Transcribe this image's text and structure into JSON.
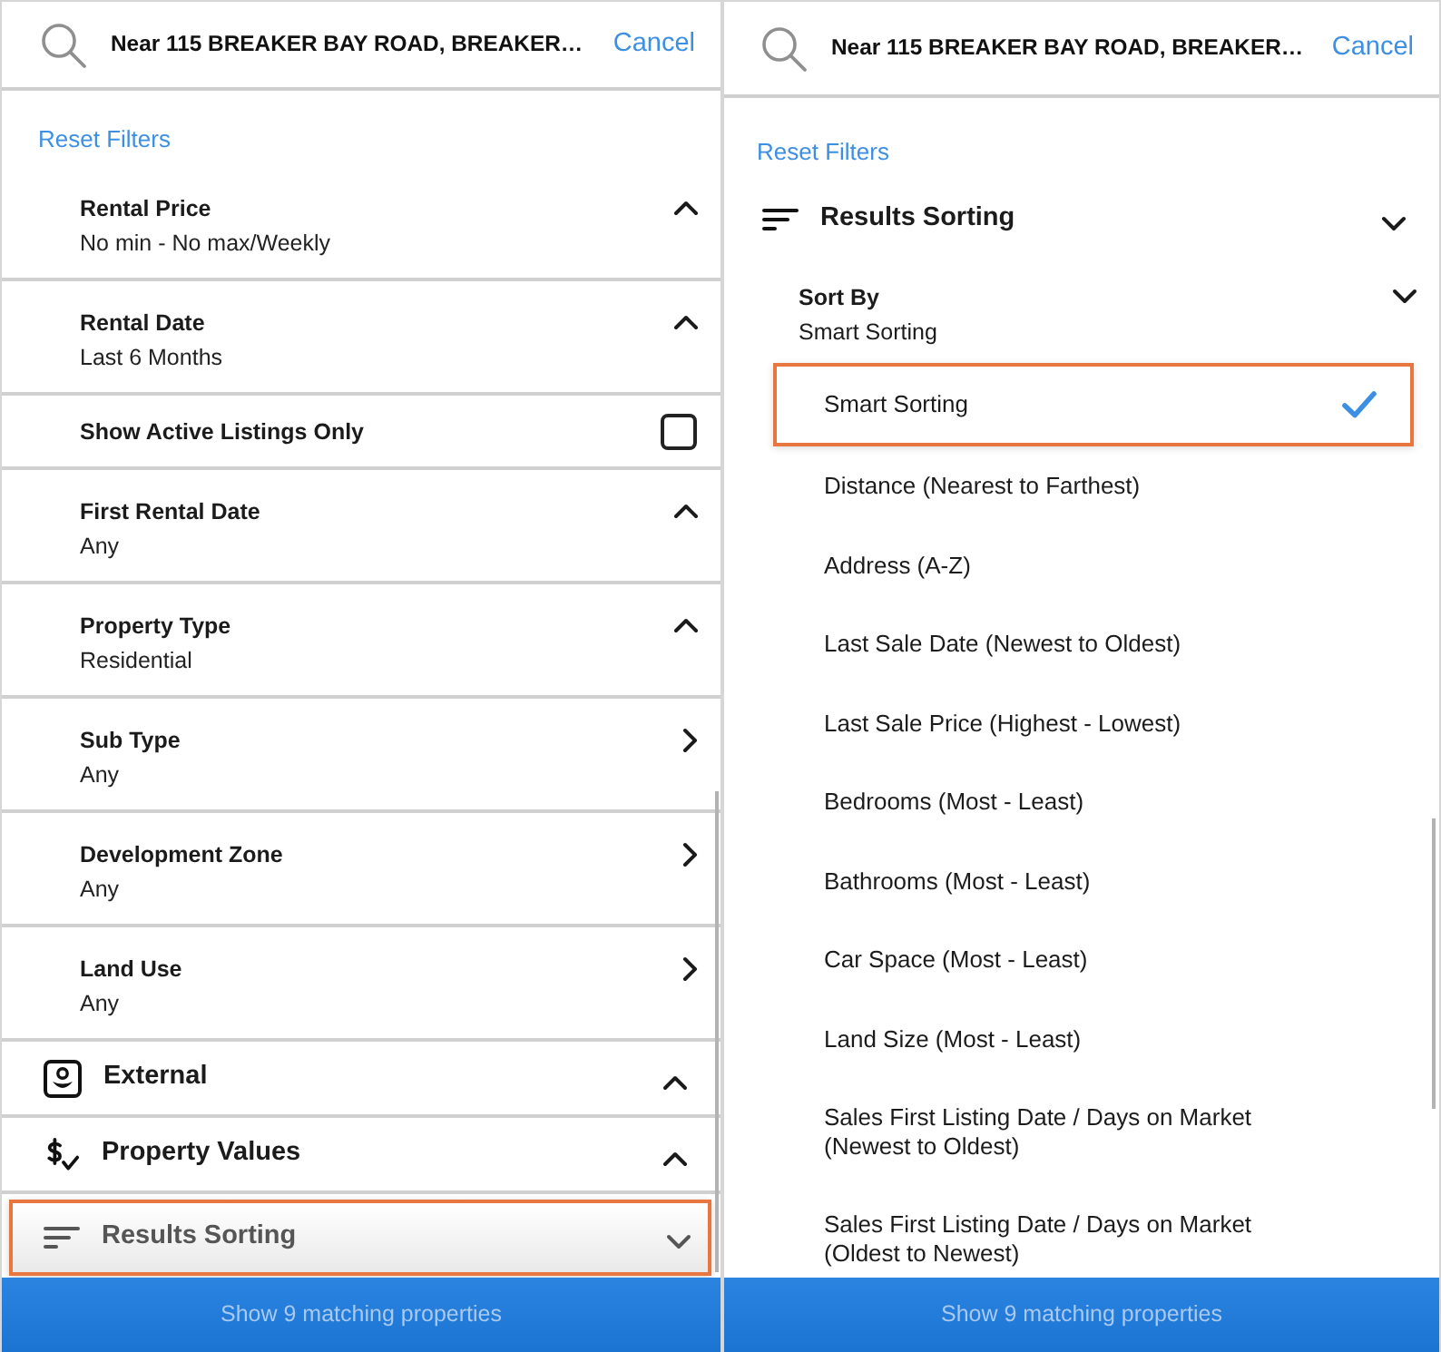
{
  "left_panel": {
    "search_text": "Near 115 BREAKER BAY ROAD, BREAKER…",
    "cancel": "Cancel",
    "reset": "Reset Filters",
    "sections": [
      {
        "kind": "filter",
        "title": "Rental Price",
        "value": "No min - No max/Weekly",
        "expanded": true,
        "highlighted": false
      },
      {
        "kind": "filter",
        "title": "Rental Date",
        "value": "Last 6 Months",
        "expanded": true,
        "highlighted": false
      },
      {
        "kind": "checkbox",
        "title": "Show Active Listings Only",
        "checked": false,
        "highlighted": false
      },
      {
        "kind": "filter",
        "title": "First Rental Date",
        "value": "Any",
        "expanded": true,
        "highlighted": false
      },
      {
        "kind": "filter",
        "title": "Property Type",
        "value": "Residential",
        "expanded": true,
        "highlighted": false
      },
      {
        "kind": "nav",
        "title": "Sub Type",
        "value": "Any",
        "highlighted": false
      },
      {
        "kind": "nav",
        "title": "Development Zone",
        "value": "Any",
        "highlighted": false
      },
      {
        "kind": "nav",
        "title": "Land Use",
        "value": "Any",
        "highlighted": false
      },
      {
        "kind": "external",
        "title": "External",
        "expanded": true,
        "highlighted": false
      },
      {
        "kind": "values",
        "title": "Property Values",
        "expanded": true,
        "highlighted": false
      },
      {
        "kind": "sorting",
        "title": "Results Sorting",
        "expanded": false,
        "highlighted": true
      }
    ],
    "button": "Show 9 matching properties"
  },
  "right_panel": {
    "search_text": "Near 115 BREAKER BAY ROAD, BREAKER…",
    "cancel": "Cancel",
    "reset": "Reset Filters",
    "section": {
      "title": "Results Sorting"
    },
    "sort_by": {
      "label": "Sort By",
      "value": "Smart Sorting"
    },
    "options": [
      {
        "label": "Smart Sorting",
        "selected": true,
        "highlighted": true
      },
      {
        "label": "Distance (Nearest to Farthest)",
        "selected": false,
        "highlighted": false
      },
      {
        "label": "Address (A-Z)",
        "selected": false,
        "highlighted": false
      },
      {
        "label": "Last Sale Date (Newest to Oldest)",
        "selected": false,
        "highlighted": false
      },
      {
        "label": "Last Sale Price (Highest - Lowest)",
        "selected": false,
        "highlighted": false
      },
      {
        "label": "Bedrooms (Most - Least)",
        "selected": false,
        "highlighted": false
      },
      {
        "label": "Bathrooms (Most - Least)",
        "selected": false,
        "highlighted": false
      },
      {
        "label": "Car Space (Most - Least)",
        "selected": false,
        "highlighted": false
      },
      {
        "label": "Land Size (Most - Least)",
        "selected": false,
        "highlighted": false
      },
      {
        "label": "Sales First Listing Date / Days on Market (Newest to Oldest)",
        "selected": false,
        "highlighted": false
      },
      {
        "label": "Sales First Listing Date / Days on Market (Oldest to Newest)",
        "selected": false,
        "highlighted": false
      }
    ],
    "button": "Show 9 matching properties"
  }
}
